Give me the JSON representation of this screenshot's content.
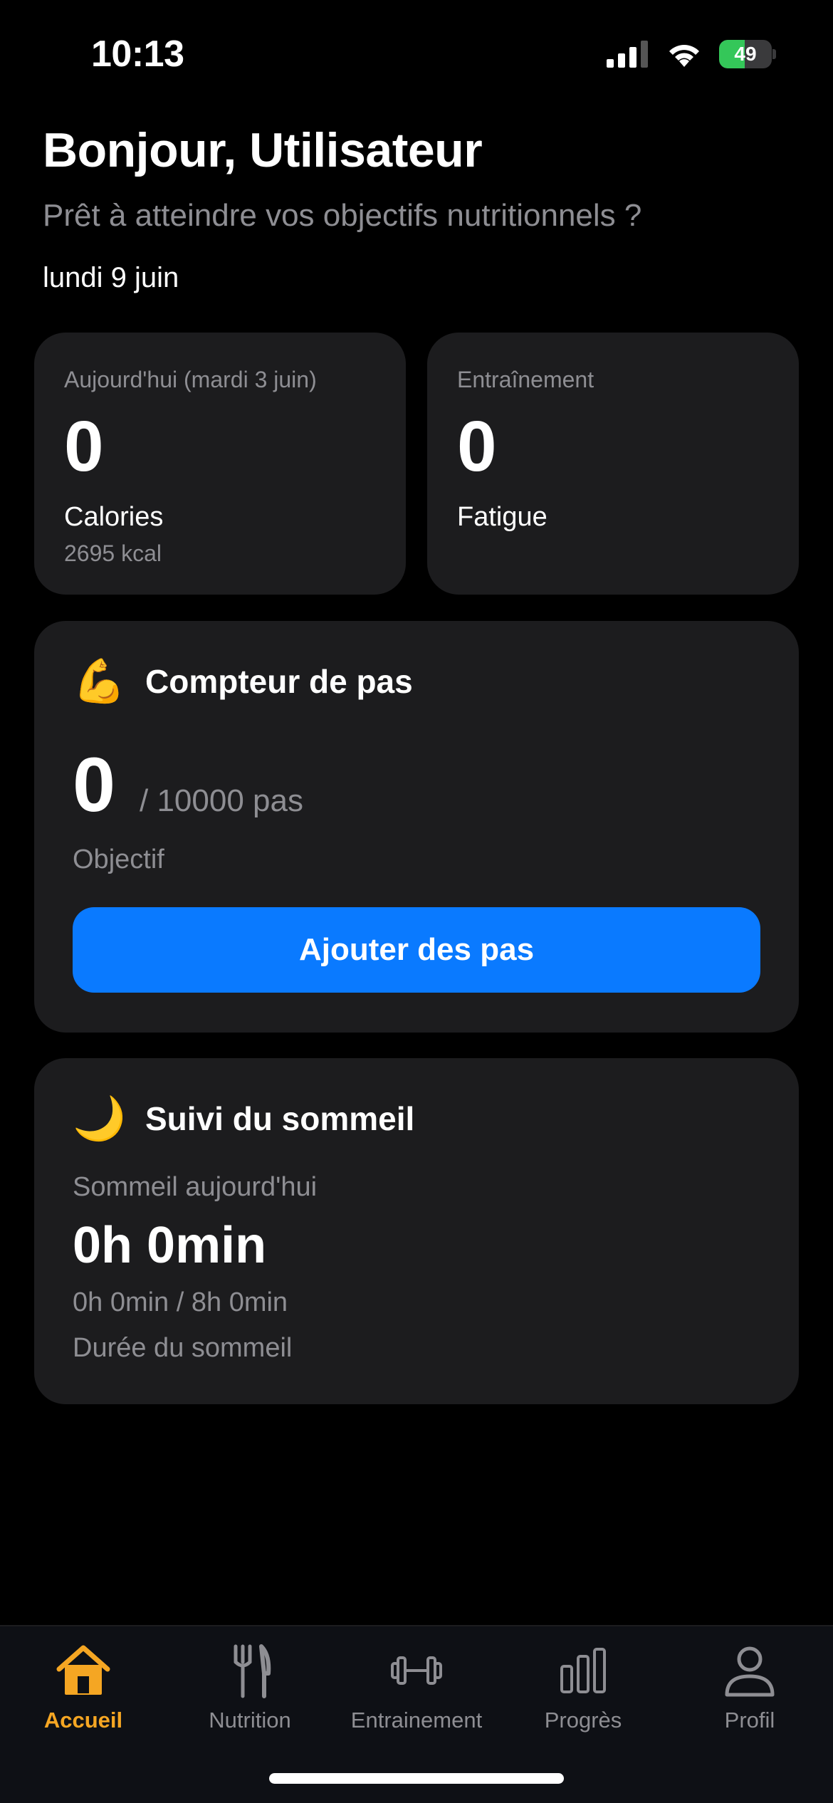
{
  "status_bar": {
    "time": "10:13",
    "battery_level": "49",
    "battery_percent": 49,
    "battery_color": "#34c759"
  },
  "header": {
    "greeting": "Bonjour, Utilisateur",
    "subtitle": "Prêt à atteindre vos objectifs nutritionnels ?",
    "date": "lundi 9 juin"
  },
  "calories_card": {
    "label": "Aujourd'hui (mardi 3 juin)",
    "value": "0",
    "metric": "Calories",
    "target": "2695 kcal"
  },
  "training_card": {
    "label": "Entraînement",
    "value": "0",
    "metric": "Fatigue"
  },
  "steps_card": {
    "icon": "flexed-biceps-icon",
    "icon_glyph": "💪",
    "title": "Compteur de pas",
    "value": "0",
    "goal": "/ 10000 pas",
    "goal_label": "Objectif",
    "button_label": "Ajouter des pas",
    "button_color": "#0a7aff"
  },
  "sleep_card": {
    "icon": "crescent-moon-icon",
    "icon_glyph": "🌙",
    "title": "Suivi du sommeil",
    "label": "Sommeil aujourd'hui",
    "value": "0h 0min",
    "progress": "0h 0min / 8h 0min",
    "description": "Durée du sommeil"
  },
  "tab_bar": {
    "active_color": "#f5a623",
    "items": [
      {
        "label": "Accueil",
        "icon": "home-icon",
        "active": true
      },
      {
        "label": "Nutrition",
        "icon": "fork-knife-icon",
        "active": false
      },
      {
        "label": "Entrainement",
        "icon": "dumbbell-icon",
        "active": false
      },
      {
        "label": "Progrès",
        "icon": "bar-chart-icon",
        "active": false
      },
      {
        "label": "Profil",
        "icon": "person-icon",
        "active": false
      }
    ]
  }
}
